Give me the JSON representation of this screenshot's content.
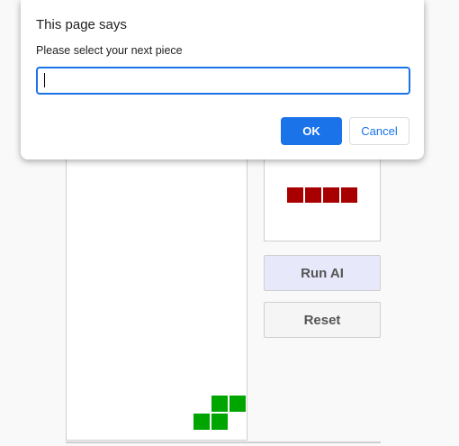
{
  "dialog": {
    "title": "This page says",
    "message": "Please select your next piece",
    "input_value": "",
    "ok_label": "OK",
    "cancel_label": "Cancel"
  },
  "game": {
    "next_piece": "I-piece",
    "current_piece": "S-piece",
    "piece_colors": {
      "next": "#a80000",
      "current": "#00a500"
    }
  },
  "controls": {
    "run_ai_label": "Run AI",
    "reset_label": "Reset"
  }
}
